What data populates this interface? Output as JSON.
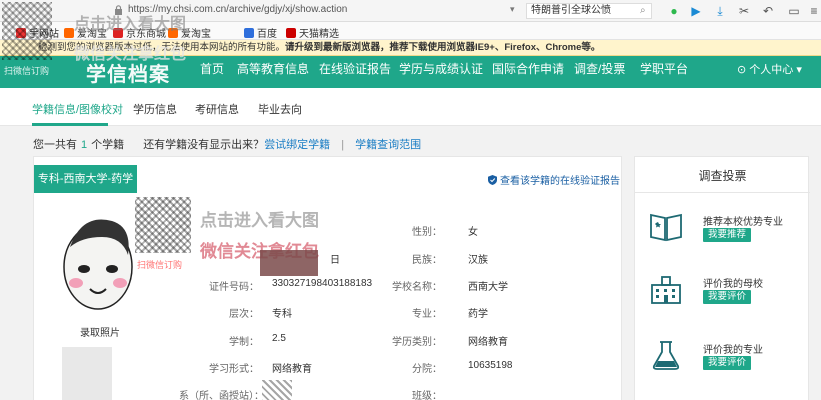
{
  "browser": {
    "url": "https://my.chsi.com.cn/archive/gdjy/xj/show.action",
    "search_text": "特朗普引全球公愤",
    "bookmarks": [
      "手网站",
      "爱淘宝",
      "京东商城",
      "爱淘宝",
      "百度",
      "天猫精选"
    ]
  },
  "notice": {
    "prefix": "检测到您的浏览器版本过低，无法使用本网站的所有功能。",
    "bold": "请升级到最新版浏览器，推荐下载使用浏览器IE9+、Firefox、Chrome等。"
  },
  "mainnav": {
    "logo": "学信档案",
    "items": [
      "首页",
      "高等教育信息",
      "在线验证报告",
      "学历与成绩认证",
      "国际合作申请",
      "调查/投票",
      "学职平台"
    ],
    "user": "个人中心"
  },
  "subnav": {
    "items": [
      "学籍信息/图像校对",
      "学历信息",
      "考研信息",
      "毕业去向"
    ]
  },
  "summary": {
    "prefix": "您一共有",
    "count": "1",
    "unit": "个学籍",
    "question": "还有学籍没有显示出来？",
    "link1": "尝试绑定学籍",
    "sep": "|",
    "link2": "学籍查询范围"
  },
  "card": {
    "tag": "专科-西南大学-药学",
    "verify_link": "查看该学籍的在线验证报告",
    "photo_caption": "录取照片",
    "fields": [
      {
        "label": "性别：",
        "value": "女"
      },
      {
        "label": "民族：",
        "value": "汉族"
      },
      {
        "label": "证件号码：",
        "value": "330327198403188183"
      },
      {
        "label": "学校名称：",
        "value": "西南大学"
      },
      {
        "label": "层次：",
        "value": "专科"
      },
      {
        "label": "专业：",
        "value": "药学"
      },
      {
        "label": "学制：",
        "value": "2.5"
      },
      {
        "label": "学历类别：",
        "value": "网络教育"
      },
      {
        "label": "学习形式：",
        "value": "网络教育"
      },
      {
        "label": "分院：",
        "value": "10635198"
      },
      {
        "label": "系（所、函授站）：",
        "value": ""
      },
      {
        "label": "班级：",
        "value": ""
      }
    ],
    "birth_fragment": "日"
  },
  "watermark": {
    "line1": "点击进入看大图",
    "line2": "微信关注拿红包",
    "small": "扫微信订购",
    "top_line1": "点击进入看大图",
    "top_line2": "微信关注拿红包",
    "top_small": "扫微信订购"
  },
  "survey": {
    "title": "调查投票",
    "items": [
      {
        "text": "推荐本校优势专业",
        "button": "我要推荐"
      },
      {
        "text": "评价我的母校",
        "button": "我要评价"
      },
      {
        "text": "评价我的专业",
        "button": "我要评价"
      }
    ]
  },
  "colors": {
    "brand": "#1fa78a",
    "link": "#1a7dc4"
  }
}
